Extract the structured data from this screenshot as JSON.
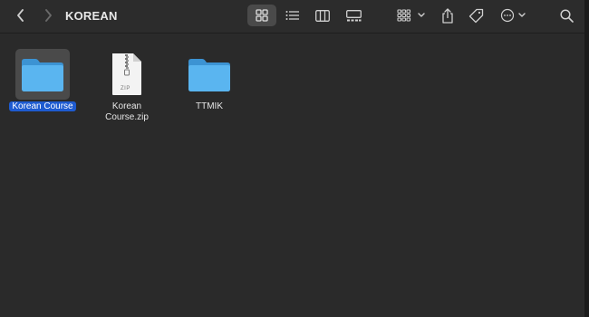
{
  "window": {
    "title": "KOREAN"
  },
  "toolbar": {
    "back_icon": "chevron-left-icon",
    "forward_icon": "chevron-right-icon",
    "view_icons": [
      "icon-view-icon",
      "list-view-icon",
      "column-view-icon",
      "gallery-view-icon"
    ],
    "group_icon": "group-by-icon",
    "share_icon": "share-icon",
    "tag_icon": "tag-icon",
    "more_icon": "more-actions-icon",
    "search_icon": "search-icon"
  },
  "files": [
    {
      "name": "Korean Course",
      "kind": "folder",
      "selected": true
    },
    {
      "name_line1": "Korean",
      "name_line2": "Course.zip",
      "badge": "ZIP",
      "kind": "zip",
      "selected": false
    },
    {
      "name": "TTMIK",
      "kind": "folder",
      "selected": false
    }
  ],
  "colors": {
    "background": "#2a2a2a",
    "selection": "#1e5bd0",
    "folder": "#5ab5f0"
  }
}
